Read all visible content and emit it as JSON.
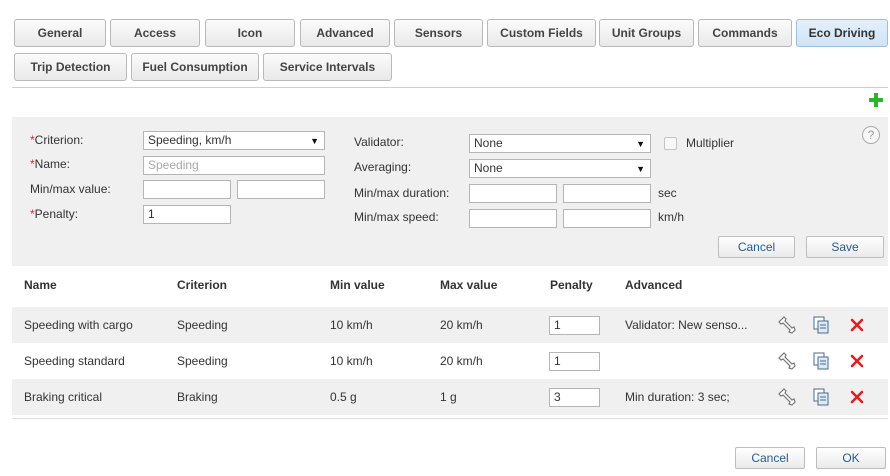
{
  "tabs": [
    "General",
    "Access",
    "Icon",
    "Advanced",
    "Sensors",
    "Custom Fields",
    "Unit Groups",
    "Commands",
    "Eco Driving",
    "Trip Detection",
    "Fuel Consumption",
    "Service Intervals"
  ],
  "active_tab": "Eco Driving",
  "form": {
    "criterion_label": "Criterion:",
    "criterion_value": "Speeding, km/h",
    "name_label": "Name:",
    "name_placeholder": "Speeding",
    "minmax_value_label": "Min/max value:",
    "penalty_label": "Penalty:",
    "penalty_value": "1",
    "validator_label": "Validator:",
    "validator_value": "None",
    "multiplier_label": "Multiplier",
    "averaging_label": "Averaging:",
    "averaging_value": "None",
    "minmax_duration_label": "Min/max duration:",
    "duration_unit": "sec",
    "minmax_speed_label": "Min/max speed:",
    "speed_unit": "km/h",
    "required_mark": "*",
    "help_glyph": "?",
    "cancel_label": "Cancel",
    "save_label": "Save"
  },
  "table": {
    "headers": [
      "Name",
      "Criterion",
      "Min value",
      "Max value",
      "Penalty",
      "Advanced"
    ],
    "rows": [
      {
        "name": "Speeding with cargo",
        "criterion": "Speeding",
        "min": "10 km/h",
        "max": "20 km/h",
        "penalty": "1",
        "advanced": "Validator: New senso..."
      },
      {
        "name": "Speeding standard",
        "criterion": "Speeding",
        "min": "10 km/h",
        "max": "20 km/h",
        "penalty": "1",
        "advanced": ""
      },
      {
        "name": "Braking critical",
        "criterion": "Braking",
        "min": "0.5 g",
        "max": "1 g",
        "penalty": "3",
        "advanced": "Min duration: 3 sec;"
      }
    ]
  },
  "footer": {
    "cancel_label": "Cancel",
    "ok_label": "OK"
  },
  "icons": {
    "add": "plus-icon",
    "edit": "wrench-icon",
    "copy": "copy-icon",
    "delete": "delete-x-icon",
    "help": "help-icon",
    "dropdown": "dropdown-arrow-icon"
  },
  "colors": {
    "add": "#2bb52b",
    "delete": "#e02020",
    "required": "#d42a2a",
    "active_tab": "#d6e9f8",
    "button_text": "#2a5b8c"
  }
}
